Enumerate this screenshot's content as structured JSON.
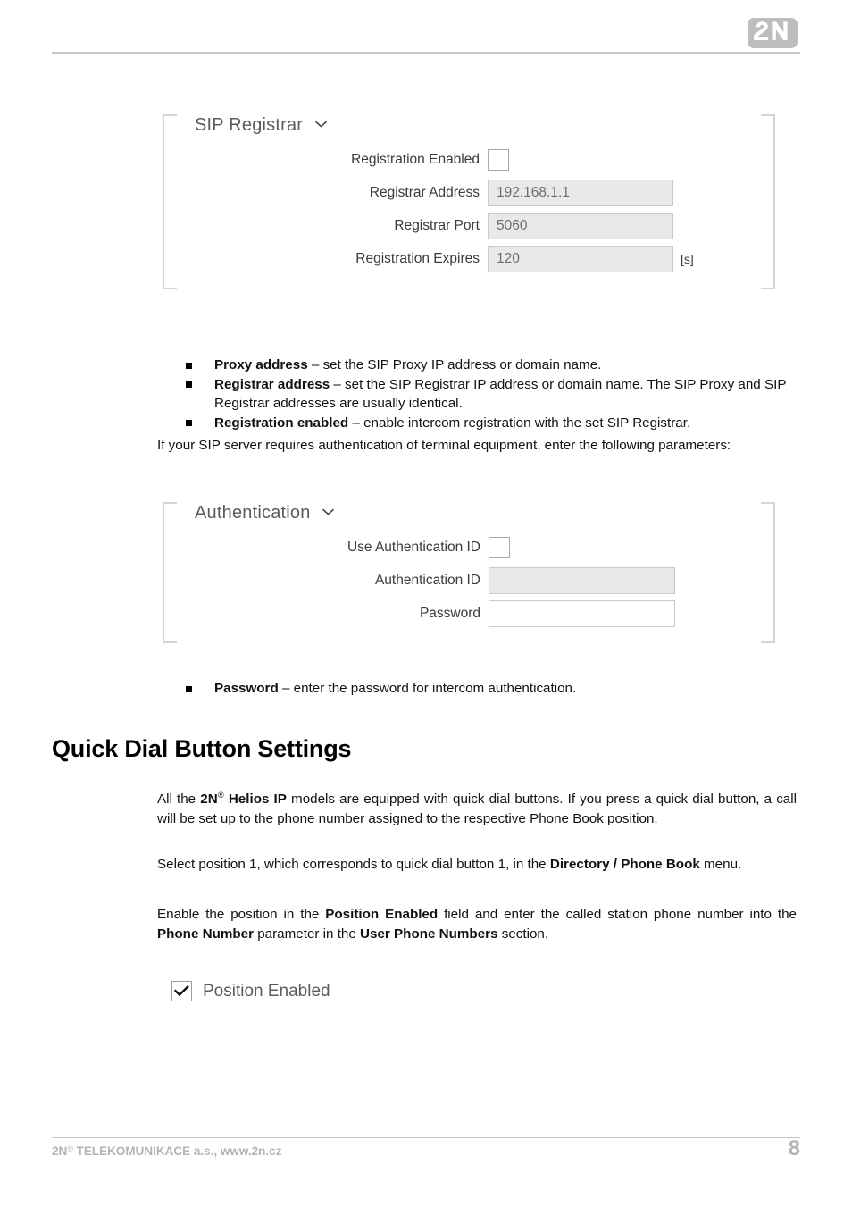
{
  "header": {
    "logo_text": "2N"
  },
  "sip_panel": {
    "title": "SIP Registrar",
    "chevron_icon": "chevron-down-icon",
    "rows": [
      {
        "label": "Registration Enabled",
        "type": "checkbox",
        "checked": false,
        "value": ""
      },
      {
        "label": "Registrar Address",
        "type": "text",
        "value": "192.168.1.1"
      },
      {
        "label": "Registrar Port",
        "type": "text",
        "value": "5060"
      },
      {
        "label": "Registration Expires",
        "type": "text",
        "value": "120",
        "unit": "[s]"
      }
    ]
  },
  "bullets_1": [
    {
      "term": "Proxy address",
      "desc": " – set the SIP Proxy IP address or domain name."
    },
    {
      "term": "Registrar address",
      "desc": " – set the SIP Registrar IP address or domain name. The SIP Proxy and SIP Registrar addresses are usually identical."
    },
    {
      "term": "Registration enabled",
      "desc": " – enable intercom registration with the set SIP Registrar."
    }
  ],
  "para_auth_intro": "If your SIP server requires authentication of terminal equipment, enter the following parameters:",
  "auth_panel": {
    "title": "Authentication",
    "chevron_icon": "chevron-down-icon",
    "rows": [
      {
        "label": "Use Authentication ID",
        "type": "checkbox",
        "checked": false,
        "value": ""
      },
      {
        "label": "Authentication ID",
        "type": "text",
        "value": ""
      },
      {
        "label": "Password",
        "type": "text-white",
        "value": ""
      }
    ]
  },
  "bullets_2": [
    {
      "term": "Password",
      "desc": " – enter the password for intercom authentication."
    }
  ],
  "section_heading": "Quick Dial Button Settings",
  "para_models": {
    "p1": "All the ",
    "brand": "2N",
    "brand_sup": "®",
    "brand2": " Helios IP",
    "p2": " models are equipped with quick dial buttons. If you press a quick dial button, a call will be set up to the phone number assigned to the respective Phone Book position."
  },
  "para_select": {
    "p1": "Select position 1, which corresponds to quick dial button 1, in the ",
    "b1": "Directory / Phone Book",
    "p2": " menu."
  },
  "para_enable": {
    "p1": "Enable the position in the ",
    "b1": "Position Enabled",
    "p2": " field and enter the called station phone number into the ",
    "b2": "Phone Number",
    "p3": " parameter in the ",
    "b3": "User Phone Numbers",
    "p4": " section."
  },
  "position_enabled": {
    "label": "Position Enabled",
    "checked": true,
    "check_icon": "checkmark-icon"
  },
  "footer": {
    "company": "2N",
    "company_sup": "®",
    "company_rest": " TELEKOMUNIKACE a.s., www.2n.cz",
    "page_number": "8"
  },
  "colors": {
    "rule": "#c6c6c6",
    "panel_bracket": "#d4d4d4",
    "field_bg": "#e9e9e9",
    "field_border": "#c9c9c9",
    "field_text": "#6e6e6e",
    "label_text": "#3a3a3a",
    "panel_title": "#5b5b5b",
    "footer_gray": "#b4b4b4"
  }
}
